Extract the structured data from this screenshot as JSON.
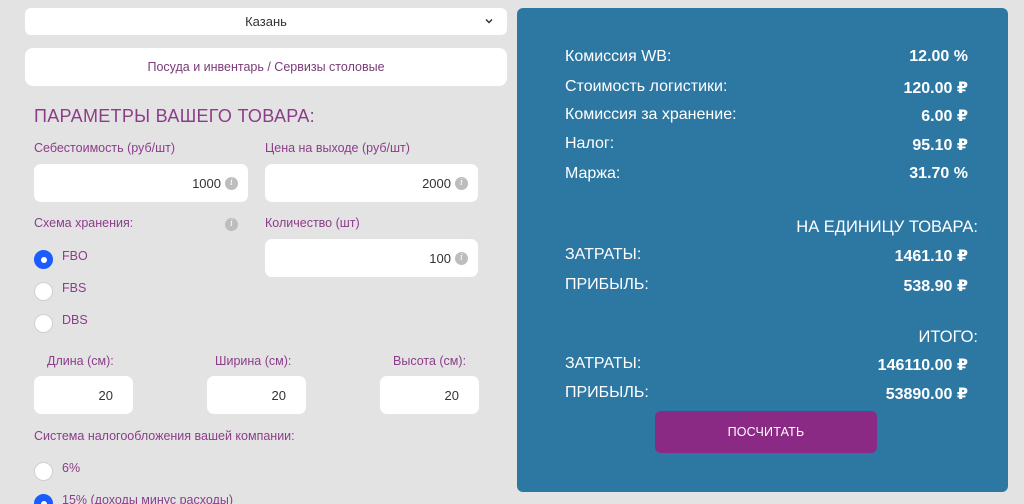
{
  "city_select": {
    "value": "Казань"
  },
  "category": {
    "label": "Посуда и инвентарь / Сервизы столовые"
  },
  "params": {
    "title": "ПАРАМЕТРЫ ВАШЕГО ТОВАРА:",
    "cost_label": "Себестоимость (руб/шт)",
    "cost_value": "1000",
    "price_label": "Цена на выходе (руб/шт)",
    "price_value": "2000",
    "storage_label": "Схема хранения:",
    "storage_options": [
      "FBO",
      "FBS",
      "DBS"
    ],
    "storage_selected": "FBO",
    "qty_label": "Количество (шт)",
    "qty_value": "100",
    "length_label": "Длина (см):",
    "length_value": "20",
    "width_label": "Ширина (см):",
    "width_value": "20",
    "height_label": "Высота (см):",
    "height_value": "20",
    "tax_label": "Система налогообложения вашей компании:",
    "tax_options": [
      "6%",
      "15% (доходы минус расходы)"
    ],
    "tax_selected": "15% (доходы минус расходы)"
  },
  "results": {
    "rows": [
      {
        "label": "Комиссия WB:",
        "value": "12.00 %"
      },
      {
        "label": "Стоимость логистики:",
        "value": "120.00 ₽"
      },
      {
        "label": "Комиссия за хранение:",
        "value": "6.00 ₽"
      },
      {
        "label": "Налог:",
        "value": "95.10 ₽"
      },
      {
        "label": "Маржа:",
        "value": "31.70 %"
      }
    ],
    "per_unit_title": "НА ЕДИНИЦУ ТОВАРА:",
    "per_unit_costs_label": "ЗАТРАТЫ:",
    "per_unit_costs_value": "1461.10 ₽",
    "per_unit_profit_label": "ПРИБЫЛЬ:",
    "per_unit_profit_value": "538.90 ₽",
    "total_title": "ИТОГО:",
    "total_costs_label": "ЗАТРАТЫ:",
    "total_costs_value": "146110.00 ₽",
    "total_profit_label": "ПРИБЫЛЬ:",
    "total_profit_value": "53890.00 ₽",
    "calc_button": "ПОСЧИТАТЬ"
  },
  "colors": {
    "panel": "#2d77a3",
    "accent": "#8b2a84",
    "label": "#8c3d8a",
    "radio_on": "#1a5cff"
  }
}
